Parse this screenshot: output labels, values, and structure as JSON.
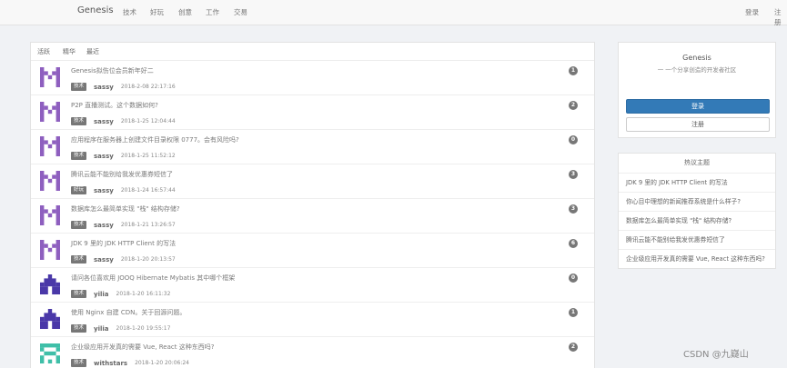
{
  "nav": {
    "brand": "Genesis",
    "links": [
      "技术",
      "好玩",
      "创意",
      "工作",
      "交易"
    ],
    "login": "登录",
    "register": "注册"
  },
  "tabs": [
    "活跃",
    "精华",
    "最近"
  ],
  "topics": [
    {
      "title": "Genesis拟伤位会员新年好二",
      "badge": "技术",
      "author": "sassy",
      "date": "2018-2-08 22:17:16",
      "count": "1"
    },
    {
      "title": "P2P 直播测试。这个数据如何?",
      "badge": "技术",
      "author": "sassy",
      "date": "2018-1-25 12:04:44",
      "count": "2"
    },
    {
      "title": "应用程序在服务器上创建文件目录权限 0777。会有风险吗?",
      "badge": "技术",
      "author": "sassy",
      "date": "2018-1-25 11:52:12",
      "count": "0"
    },
    {
      "title": "腾讯云能不能别给我发优惠券短信了",
      "badge": "好玩",
      "author": "sassy",
      "date": "2018-1-24 16:57:44",
      "count": "3"
    },
    {
      "title": "数据库怎么最简单实现 \"栈\" 结构存储?",
      "badge": "技术",
      "author": "sassy",
      "date": "2018-1-21 13:26:57",
      "count": "3"
    },
    {
      "title": "JDK 9 里的 JDK HTTP Client 的写法",
      "badge": "技术",
      "author": "sassy",
      "date": "2018-1-20 20:13:57",
      "count": "6"
    },
    {
      "title": "请问各位喜欢用 JOOQ Hibernate Mybatis 其中哪个框架",
      "badge": "技术",
      "author": "yilia",
      "date": "2018-1-20 16:11:32",
      "count": "0"
    },
    {
      "title": "使用 Nginx 自建 CDN。关于回源问题。",
      "badge": "技术",
      "author": "yilia",
      "date": "2018-1-20 19:55:17",
      "count": "1"
    },
    {
      "title": "企业级应用开发真的需要 Vue, React 这种东西吗?",
      "badge": "技术",
      "author": "withstars",
      "date": "2018-1-20 20:06:24",
      "count": "2"
    }
  ],
  "sidebar": {
    "title": "Genesis",
    "slogan": "一 一个分享创造的开发者社区",
    "login_button": "登录",
    "register_button": "注册",
    "hot_title": "热议主题",
    "hot_topics": [
      "JDK 9 里的 JDK HTTP Client 的写法",
      "你心目中理想的新闻推荐系统是什么样子?",
      "数据库怎么最简单实现 \"栈\" 结构存储?",
      "腾讯云能不能别给我发优惠券短信了",
      "企业级应用开发真的需要 Vue, React 这种东西吗?"
    ]
  },
  "watermark": "CSDN @九嶷山",
  "colors": {
    "primary": "#337ab7",
    "badge": "#777777",
    "avatar_purple": "#8e5fbf",
    "avatar_indigo": "#4a38a8",
    "avatar_teal": "#3fbfa8"
  }
}
